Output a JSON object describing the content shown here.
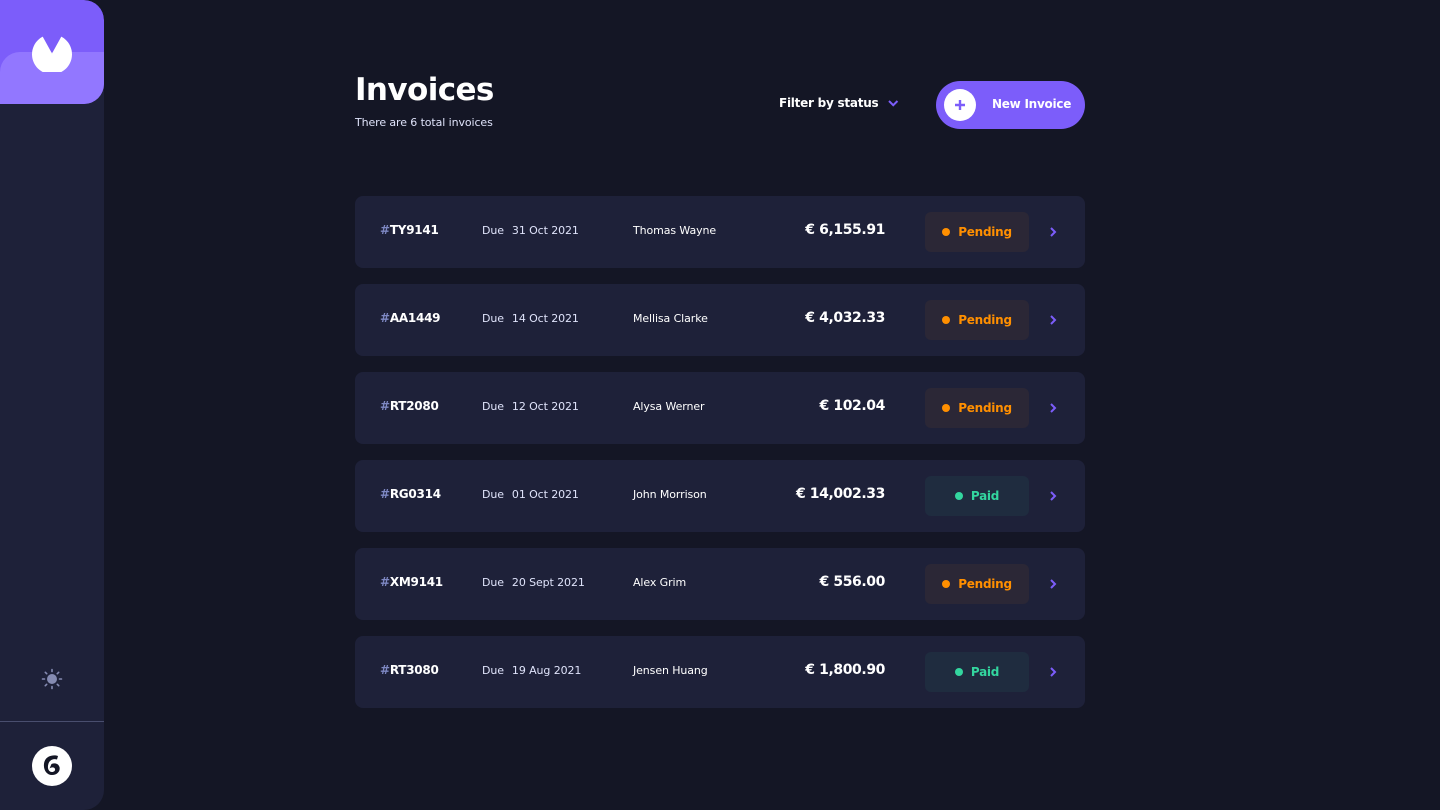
{
  "header": {
    "title": "Invoices",
    "subtitle": "There are 6 total invoices",
    "filter_label": "Filter by status",
    "new_invoice_label": "New Invoice"
  },
  "sidebar": {
    "logo_icon": "logo-icon",
    "theme_icon": "sun-icon",
    "avatar_icon": "avatar-icon"
  },
  "colors": {
    "accent": "#7c5dfa",
    "background": "#141625",
    "card": "#1e2139",
    "pending": "#ff8f00",
    "paid": "#33d69f"
  },
  "invoices": [
    {
      "hash": "#",
      "id": "TY9141",
      "due_label": "Due",
      "due_date": "31 Oct 2021",
      "client": "Thomas Wayne",
      "amount": "€ 6,155.91",
      "status": "Pending",
      "status_type": "pending"
    },
    {
      "hash": "#",
      "id": "AA1449",
      "due_label": "Due",
      "due_date": "14 Oct 2021",
      "client": "Mellisa Clarke",
      "amount": "€ 4,032.33",
      "status": "Pending",
      "status_type": "pending"
    },
    {
      "hash": "#",
      "id": "RT2080",
      "due_label": "Due",
      "due_date": "12 Oct 2021",
      "client": "Alysa Werner",
      "amount": "€ 102.04",
      "status": "Pending",
      "status_type": "pending"
    },
    {
      "hash": "#",
      "id": "RG0314",
      "due_label": "Due",
      "due_date": "01 Oct 2021",
      "client": "John Morrison",
      "amount": "€ 14,002.33",
      "status": "Paid",
      "status_type": "paid"
    },
    {
      "hash": "#",
      "id": "XM9141",
      "due_label": "Due",
      "due_date": "20 Sept 2021",
      "client": "Alex Grim",
      "amount": "€ 556.00",
      "status": "Pending",
      "status_type": "pending"
    },
    {
      "hash": "#",
      "id": "RT3080",
      "due_label": "Due",
      "due_date": "19 Aug 2021",
      "client": "Jensen Huang",
      "amount": "€ 1,800.90",
      "status": "Paid",
      "status_type": "paid"
    }
  ]
}
